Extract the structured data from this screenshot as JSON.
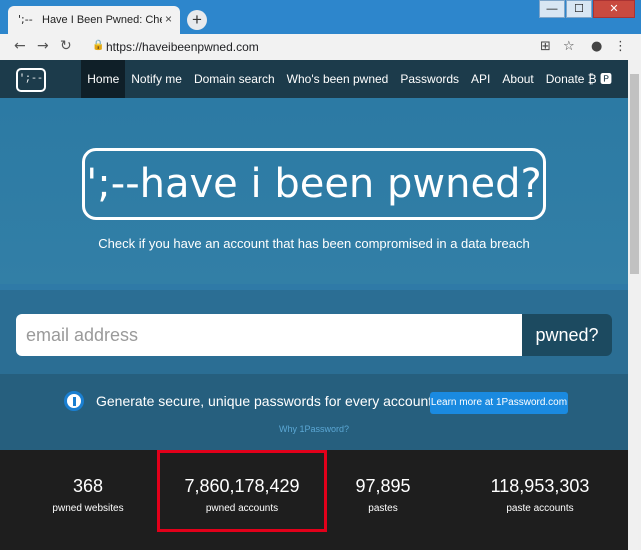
{
  "browser": {
    "tab_favicon": "';--",
    "tab_title": "Have I Been Pwned: Check if",
    "tab_close": "×",
    "new_tab": "+",
    "url": "https://haveibeenpwned.com",
    "window_min": "—",
    "window_max": "☐",
    "window_close": "✕"
  },
  "nav": {
    "logo": "';--",
    "links": [
      "Home",
      "Notify me",
      "Domain search",
      "Who's been pwned",
      "Passwords",
      "API",
      "About",
      "Donate ₿ 🅿"
    ]
  },
  "hero": {
    "title": "';--have i been pwned?",
    "tagline": "Check if you have an account that has been compromised in a data breach"
  },
  "search": {
    "placeholder": "email address",
    "button": "pwned?"
  },
  "promo": {
    "text": "Generate secure, unique passwords for every account",
    "button": "Learn more at 1Password.com",
    "why": "Why 1Password?"
  },
  "stats": [
    {
      "value": "368",
      "label": "pwned websites"
    },
    {
      "value": "7,860,178,429",
      "label": "pwned accounts"
    },
    {
      "value": "97,895",
      "label": "pastes"
    },
    {
      "value": "118,953,303",
      "label": "paste accounts"
    }
  ],
  "colors": {
    "accent": "#1a8ae0",
    "highlight": "#e2001a",
    "nav": "#1c3b4b"
  }
}
